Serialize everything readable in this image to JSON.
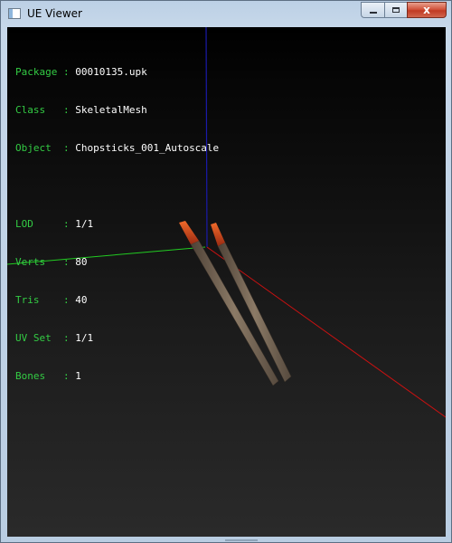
{
  "window": {
    "title": "UE Viewer",
    "app_icon": "window-app-icon",
    "buttons": {
      "minimize_icon": "minimize-icon",
      "maximize_icon": "maximize-icon",
      "close_icon": "close-icon",
      "close_glyph": "x"
    }
  },
  "overlay": {
    "group1": [
      {
        "key": "Package",
        "sep": ":",
        "value": "00010135.upk"
      },
      {
        "key": "Class  ",
        "sep": ":",
        "value": "SkeletalMesh"
      },
      {
        "key": "Object ",
        "sep": ":",
        "value": "Chopsticks_001_Autoscale"
      }
    ],
    "group2": [
      {
        "key": "LOD    ",
        "sep": ":",
        "value": "1/1"
      },
      {
        "key": "Verts  ",
        "sep": ":",
        "value": "80"
      },
      {
        "key": "Tris   ",
        "sep": ":",
        "value": "40"
      },
      {
        "key": "UV Set ",
        "sep": ":",
        "value": "1/1"
      },
      {
        "key": "Bones  ",
        "sep": ":",
        "value": "1"
      }
    ]
  },
  "colors": {
    "label_green": "#33cc44",
    "value_white": "#ffffff",
    "axis_x": "#cc1111",
    "axis_y": "#22cc22",
    "axis_z": "#1a1aaa",
    "stick_wood": "#7a6a58",
    "stick_tip": "#d84a1c"
  }
}
